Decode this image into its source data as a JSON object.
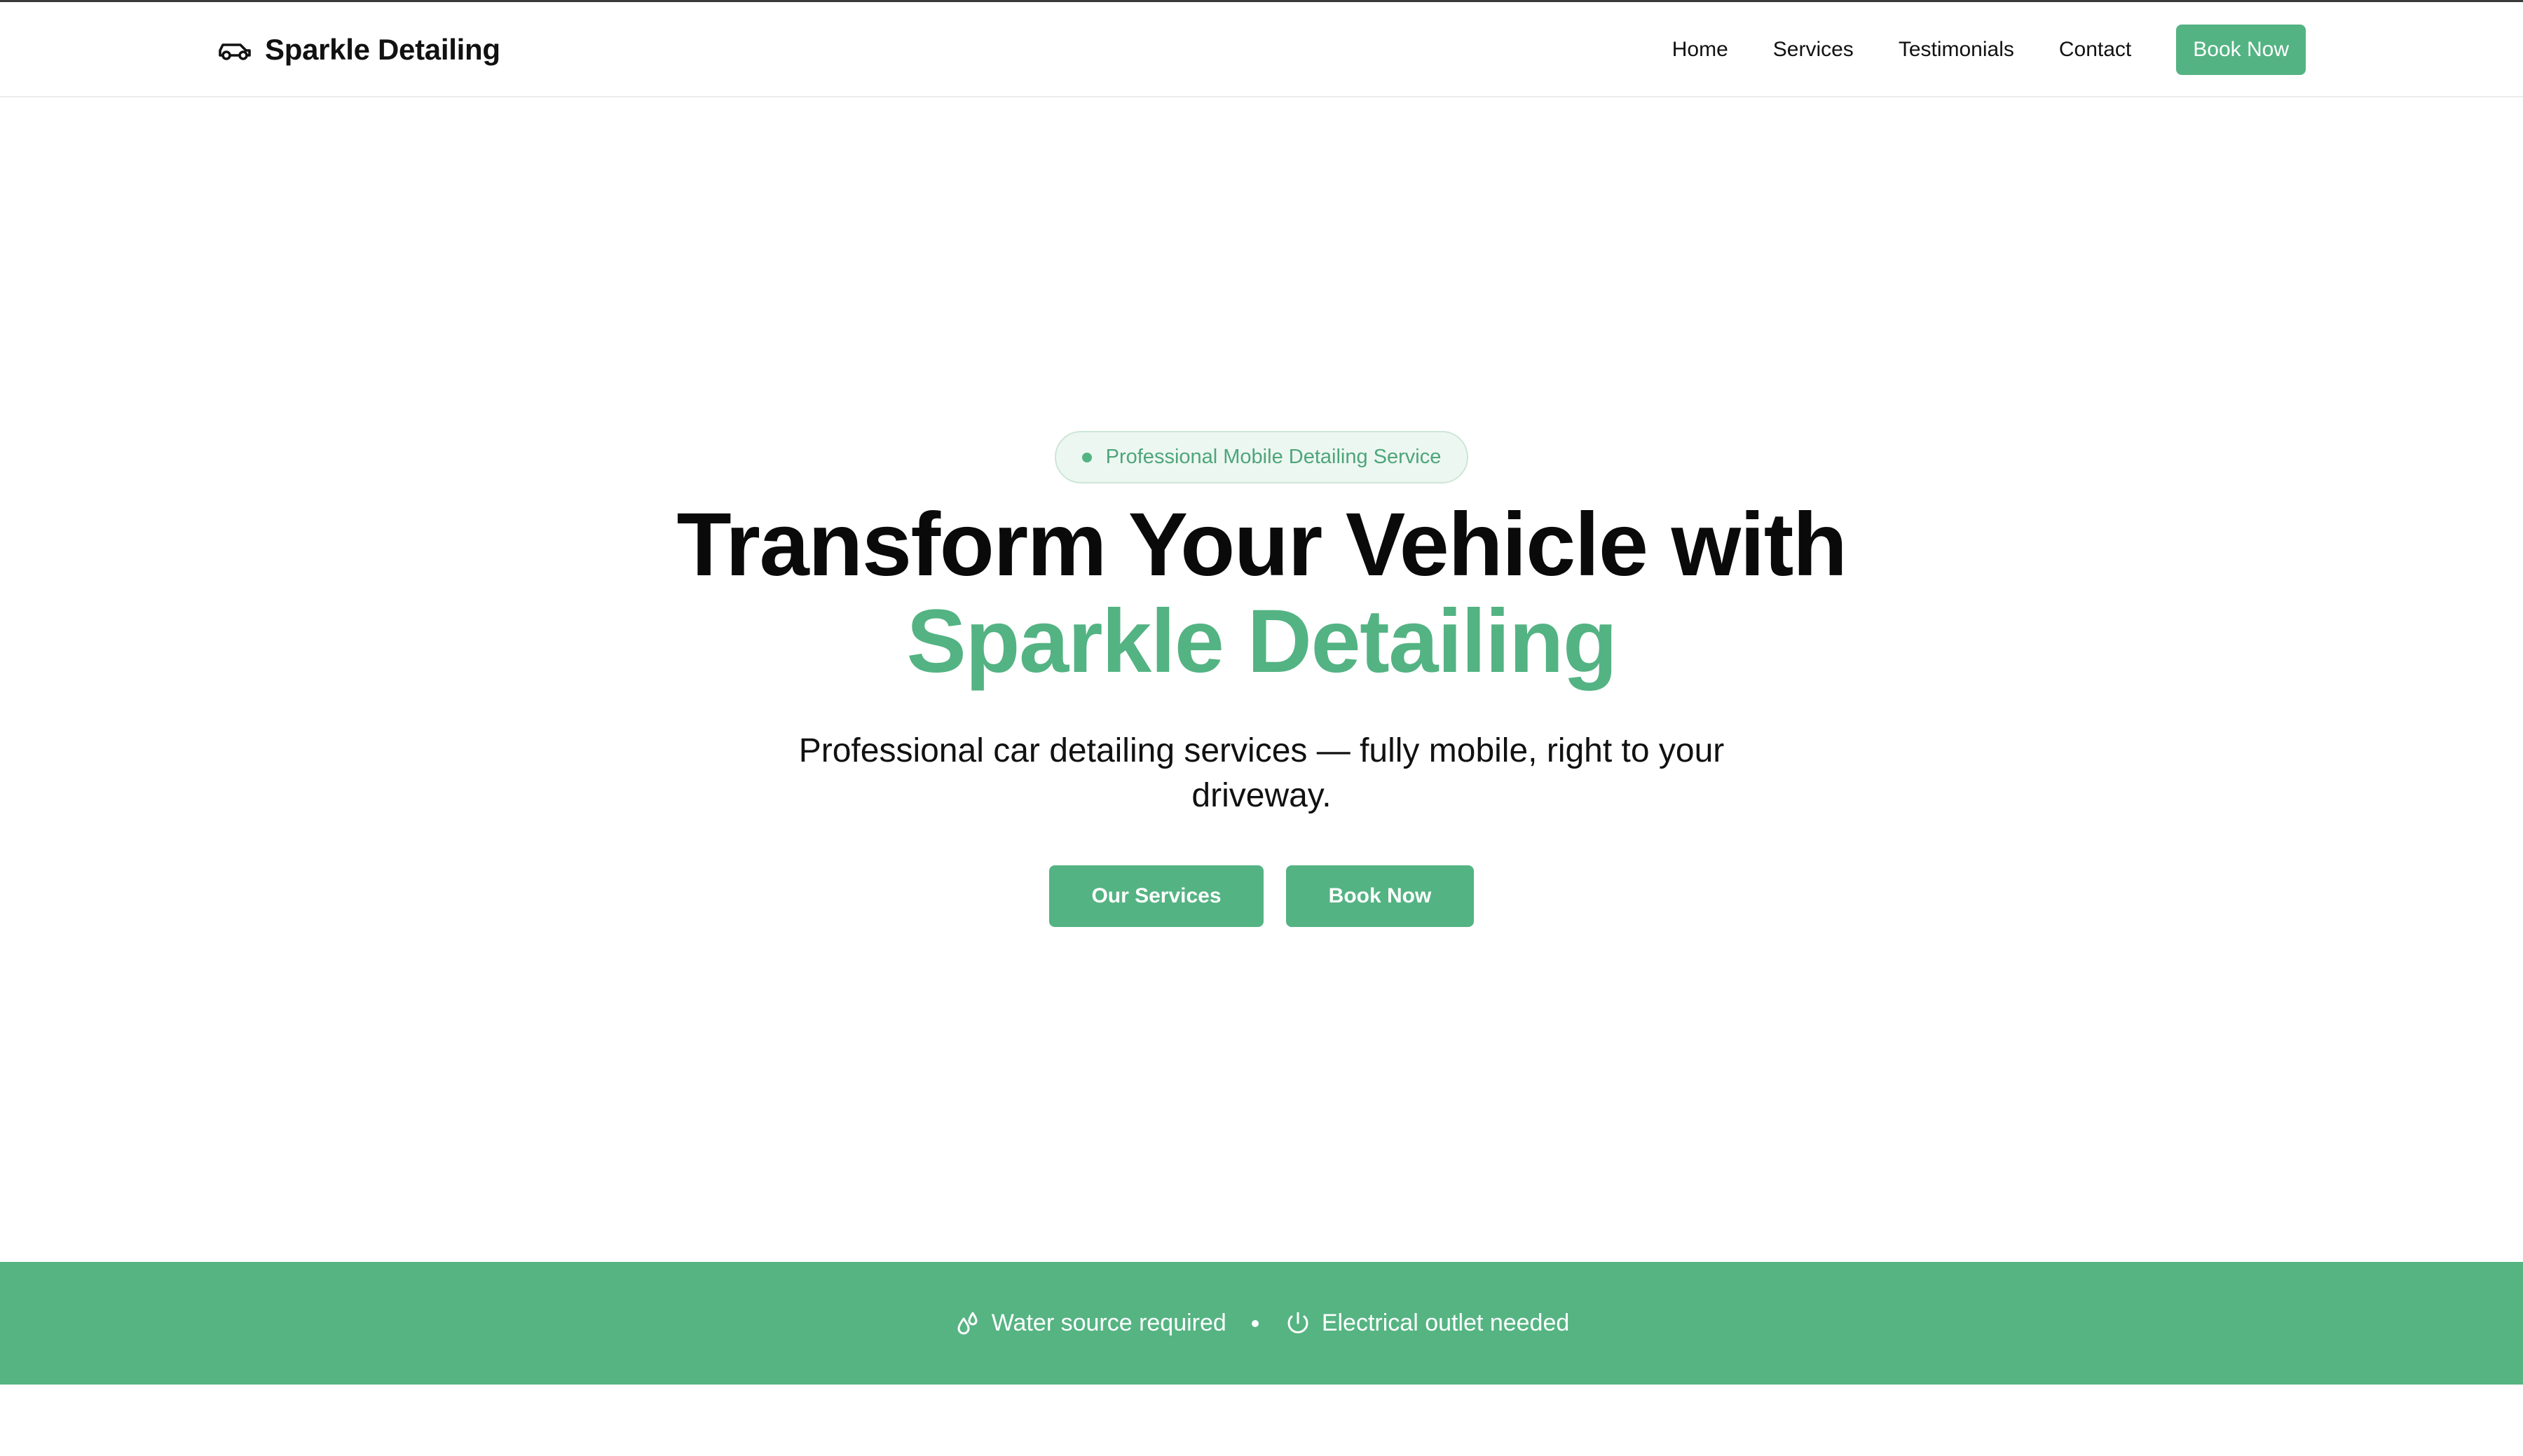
{
  "header": {
    "brand": "Sparkle Detailing",
    "nav": [
      "Home",
      "Services",
      "Testimonials",
      "Contact"
    ],
    "cta": "Book Now"
  },
  "hero": {
    "badge": "Professional Mobile Detailing Service",
    "headline_line1": "Transform Your Vehicle with",
    "headline_line2": "Sparkle Detailing",
    "subtitle": "Professional car detailing services — fully mobile, right to your driveway.",
    "primary_button": "Our Services",
    "secondary_button": "Book Now"
  },
  "requirements": {
    "item1": "Water source required",
    "item2": "Electrical outlet needed"
  },
  "colors": {
    "accent": "#54b383",
    "text": "#0a0a0a",
    "badge_bg": "#edf7f1"
  },
  "icons": {
    "brand": "car-icon",
    "water": "droplets-icon",
    "power": "power-icon"
  }
}
